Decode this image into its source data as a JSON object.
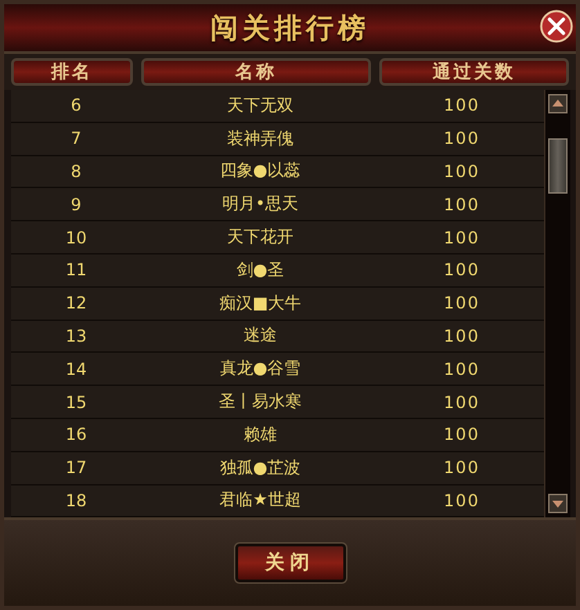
{
  "window": {
    "title": "闯关排行榜"
  },
  "table": {
    "columns": [
      "排名",
      "名称",
      "通过关数"
    ],
    "rows": [
      {
        "rank": "6",
        "name": "天下无双",
        "stages": "100"
      },
      {
        "rank": "7",
        "name": "装神弄傀",
        "stages": "100"
      },
      {
        "rank": "8",
        "name": "四象●以蕊",
        "stages": "100"
      },
      {
        "rank": "9",
        "name": "明月•思天",
        "stages": "100"
      },
      {
        "rank": "10",
        "name": "天下花开",
        "stages": "100"
      },
      {
        "rank": "11",
        "name": "剑●圣",
        "stages": "100"
      },
      {
        "rank": "12",
        "name": "痴汉■大牛",
        "stages": "100"
      },
      {
        "rank": "13",
        "name": "迷途",
        "stages": "100"
      },
      {
        "rank": "14",
        "name": "真龙●谷雪",
        "stages": "100"
      },
      {
        "rank": "15",
        "name": "圣丨易水寒",
        "stages": "100"
      },
      {
        "rank": "16",
        "name": "赖雄",
        "stages": "100"
      },
      {
        "rank": "17",
        "name": "独孤●芷波",
        "stages": "100"
      },
      {
        "rank": "18",
        "name": "君临★世超",
        "stages": "100"
      }
    ]
  },
  "buttons": [
    "关闭"
  ]
}
